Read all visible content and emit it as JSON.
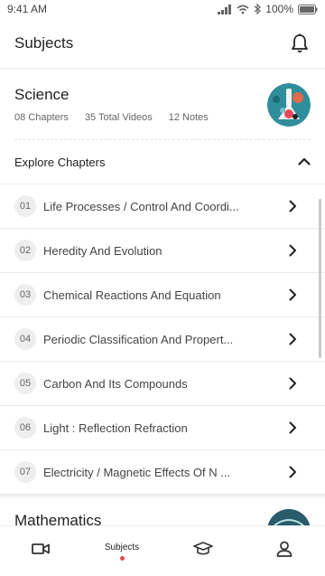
{
  "status": {
    "time": "9:41 AM",
    "battery": "100%"
  },
  "header": {
    "title": "Subjects",
    "icon": "bell-icon"
  },
  "subject": {
    "name": "Science",
    "chapters": "08 Chapters",
    "videos": "35 Total Videos",
    "notes": "12 Notes"
  },
  "explore": {
    "label": "Explore Chapters"
  },
  "chapters": [
    {
      "num": "01",
      "title": "Life Processes / Control And Coordi..."
    },
    {
      "num": "02",
      "title": "Heredity And Evolution"
    },
    {
      "num": "03",
      "title": "Chemical Reactions And Equation"
    },
    {
      "num": "04",
      "title": "Periodic Classification And Propert..."
    },
    {
      "num": "05",
      "title": "Carbon And Its Compounds"
    },
    {
      "num": "06",
      "title": "Light : Reflection Refraction"
    },
    {
      "num": "07",
      "title": "Electricity / Magnetic Effects Of N ..."
    }
  ],
  "next_subject": {
    "name": "Mathematics"
  },
  "nav": {
    "items": [
      {
        "icon": "video-icon",
        "label": ""
      },
      {
        "icon": "",
        "label": "Subjects"
      },
      {
        "icon": "graduation-cap-icon",
        "label": ""
      },
      {
        "icon": "profile-icon",
        "label": ""
      }
    ],
    "dot_color": "#e8485b"
  }
}
